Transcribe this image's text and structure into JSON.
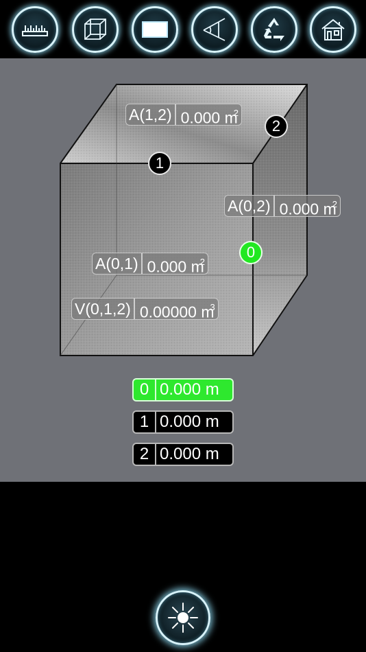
{
  "toolbar": {
    "buttons": [
      {
        "name": "ruler-tool-button",
        "icon": "ruler-icon"
      },
      {
        "name": "cube-tool-button",
        "icon": "wireframe-cube-icon"
      },
      {
        "name": "rectangle-tool-button",
        "icon": "rectangle-icon"
      },
      {
        "name": "angle-tool-button",
        "icon": "angle-icon"
      },
      {
        "name": "reset-button",
        "icon": "recycle-icon"
      },
      {
        "name": "home-button",
        "icon": "house-icon"
      }
    ]
  },
  "measurements": {
    "area_12": {
      "label": "A(1,2)",
      "value": "0.000 m",
      "unit_exp": "2"
    },
    "area_02": {
      "label": "A(0,2)",
      "value": "0.000 m",
      "unit_exp": "2"
    },
    "area_01": {
      "label": "A(0,1)",
      "value": "0.000 m",
      "unit_exp": "2"
    },
    "volume_012": {
      "label": "V(0,1,2)",
      "value": "0.00000 m",
      "unit_exp": "3"
    }
  },
  "markers": {
    "m0": "0",
    "m1": "1",
    "m2": "2"
  },
  "dimensions": [
    {
      "index": "0",
      "length": "0.000 m",
      "active": true
    },
    {
      "index": "1",
      "length": "0.000 m",
      "active": false
    },
    {
      "index": "2",
      "length": "0.000 m",
      "active": false
    }
  ],
  "bottom": {
    "light_button_icon": "sun-icon"
  },
  "colors": {
    "active_green": "#2ee82e",
    "work_area": "#6f7177",
    "glow": "#d8f3fb"
  }
}
